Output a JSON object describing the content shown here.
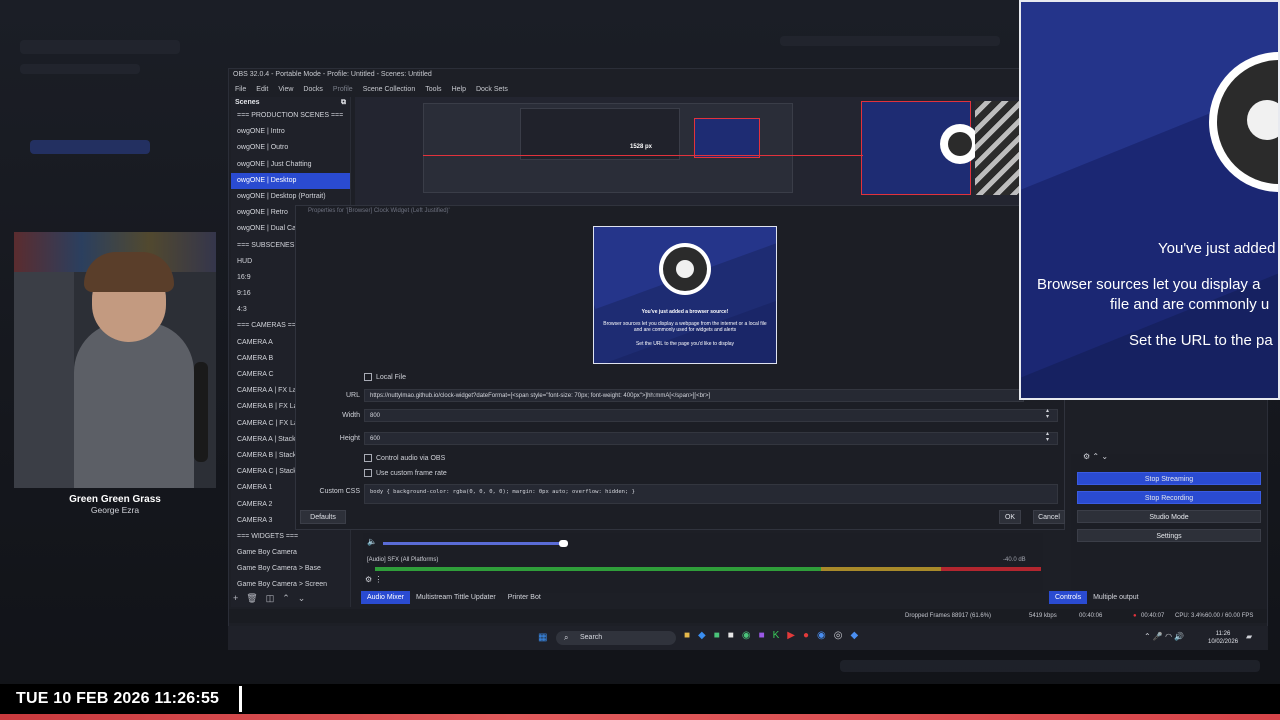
{
  "obs": {
    "window_title": "OBS 32.0.4 - Portable Mode - Profile: Untitled - Scenes: Untitled",
    "menu": [
      "File",
      "Edit",
      "View",
      "Docks",
      "Profile",
      "Scene Collection",
      "Tools",
      "Help",
      "Dock Sets"
    ]
  },
  "scenes": {
    "title": "Scenes",
    "items": [
      "=== PRODUCTION SCENES ===",
      "owgONE | Intro",
      "owgONE | Outro",
      "owgONE | Just Chatting",
      "owgONE | Desktop",
      "owgONE | Desktop (Portrait)",
      "owgONE | Retro",
      "owgONE | Dual Ca",
      "=== SUBSCENES ===",
      "HUD",
      "16:9",
      "9:16",
      "4:3",
      "=== CAMERAS ===",
      "CAMERA A",
      "CAMERA B",
      "CAMERA C",
      "CAMERA A | FX La",
      "CAMERA B | FX La",
      "CAMERA C | FX La",
      "CAMERA A | Stack",
      "CAMERA B | Stack",
      "CAMERA C | Stack",
      "CAMERA 1",
      "CAMERA 2",
      "CAMERA 3",
      "=== WIDGETS ===",
      "Game Boy Camera",
      "Game Boy Camera > Base",
      "Game Boy Camera > Screen"
    ],
    "active_index": 4,
    "footer_icons": [
      "+",
      "🗑",
      "◫",
      "⌃",
      "⌄"
    ]
  },
  "preview": {
    "dimension_label": "1528 px"
  },
  "properties": {
    "title": "Properties for '[Browser] Clock Widget (Left Justified)'",
    "browser_preview": {
      "line1": "You've just added a browser source!",
      "line2": "Browser sources let you display a webpage from the internet or a local file and are commonly used for widgets and alerts",
      "line3": "Set the URL to the page you'd like to display"
    },
    "local_file_label": "Local File",
    "url_label": "URL",
    "url_value": "https://nuttylmao.github.io/clock-widget?dateFormat=[<span style=\"font-size: 70px; font-weight: 400px\">]hh:mmA[</span>][<br>]",
    "width_label": "Width",
    "width_value": "800",
    "height_label": "Height",
    "height_value": "600",
    "control_audio_label": "Control audio via OBS",
    "custom_frame_rate_label": "Use custom frame rate",
    "custom_css_label": "Custom CSS",
    "custom_css_value": "body { background-color: rgba(0, 0, 0, 0); margin: 0px auto; overflow: hidden; }",
    "defaults_label": "Defaults",
    "ok_label": "OK",
    "cancel_label": "Cancel"
  },
  "mixer": {
    "channel_name": "[Audio] SFX (All Platforms)",
    "level": "-40.0 dB",
    "tabs": [
      "Audio Mixer",
      "Multistream Tittle Updater",
      "Printer Bot"
    ],
    "active_tab": 0
  },
  "controls": {
    "start_streaming": "Stop Streaming",
    "stop_recording": "Stop Recording",
    "studio_mode": "Studio Mode",
    "settings": "Settings",
    "tabs": [
      "Controls",
      "Multiple output"
    ]
  },
  "status": {
    "dropped_frames": "Dropped Frames 88917 (61.6%)",
    "bitrate": "5419 kbps",
    "stream_time": "00:40:06",
    "rec_time": "00:40:07",
    "cpu": "CPU: 3.4%",
    "fps": "60.00 / 60.00 FPS"
  },
  "taskbar": {
    "search_label": "Search",
    "time": "11:26",
    "date": "10/02/2026"
  },
  "zoom_preview": {
    "line1": "You've just added",
    "line2": "Browser sources let you display a",
    "line3": "file and are commonly u",
    "line4": "Set the URL to the pa"
  },
  "webcam": {
    "song_title": "Green Green Grass",
    "artist": "George Ezra"
  },
  "overlay": {
    "datetime": "TUE 10 FEB 2026 11:26:55"
  },
  "colors": {
    "accent_blue": "#2a4bd1",
    "browser_bg": "#1e2c73",
    "record_red": "#e2323c"
  }
}
